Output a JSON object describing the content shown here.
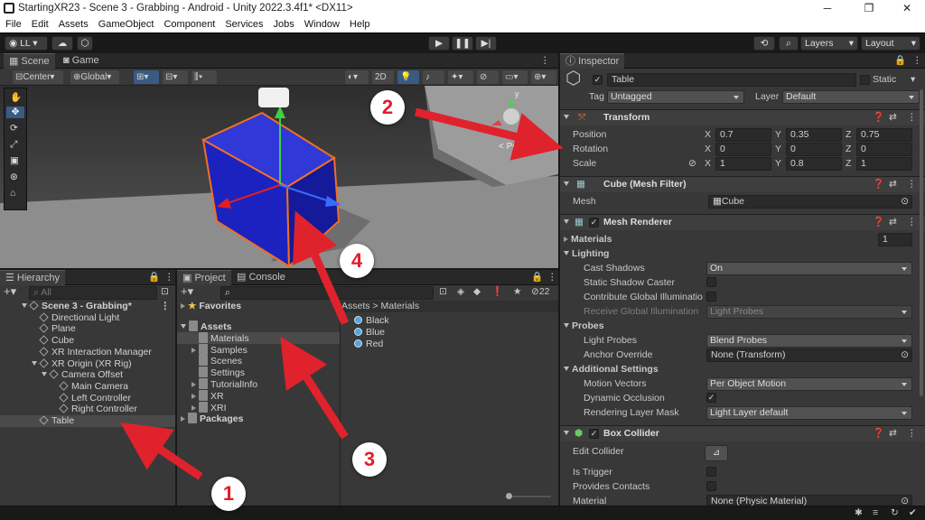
{
  "window": {
    "title": "StartingXR23 - Scene 3 - Grabbing - Android - Unity 2022.3.4f1* <DX11>",
    "min": "─",
    "max": "❐",
    "close": "✕"
  },
  "menu": [
    "File",
    "Edit",
    "Assets",
    "GameObject",
    "Component",
    "Services",
    "Jobs",
    "Window",
    "Help"
  ],
  "toolbar": {
    "account": "LL",
    "layers": "Layers",
    "layout": "Layout"
  },
  "scene": {
    "tab_scene": "Scene",
    "tab_game": "Game",
    "pivot": "Center",
    "space": "Global",
    "mode_2d": "2D",
    "persp": "< Persp",
    "axis_y": "y"
  },
  "hierarchy": {
    "tab": "Hierarchy",
    "search_placeholder": "All",
    "items": [
      {
        "label": "Scene 3 - Grabbing*",
        "depth": 0,
        "kind": "scene",
        "expanded": true
      },
      {
        "label": "Directional Light",
        "depth": 1,
        "kind": "object"
      },
      {
        "label": "Plane",
        "depth": 1,
        "kind": "object"
      },
      {
        "label": "Cube",
        "depth": 1,
        "kind": "object"
      },
      {
        "label": "XR Interaction Manager",
        "depth": 1,
        "kind": "object"
      },
      {
        "label": "XR Origin (XR Rig)",
        "depth": 1,
        "kind": "object",
        "expanded": true
      },
      {
        "label": "Camera Offset",
        "depth": 2,
        "kind": "object",
        "expanded": true
      },
      {
        "label": "Main Camera",
        "depth": 3,
        "kind": "object"
      },
      {
        "label": "Left Controller",
        "depth": 3,
        "kind": "object"
      },
      {
        "label": "Right Controller",
        "depth": 3,
        "kind": "object"
      },
      {
        "label": "Table",
        "depth": 1,
        "kind": "object",
        "selected": true
      }
    ]
  },
  "project": {
    "tab_project": "Project",
    "tab_console": "Console",
    "hidden_count": "22",
    "favorites": "Favorites",
    "tree": [
      {
        "label": "Assets",
        "depth": 0,
        "expanded": true
      },
      {
        "label": "Materials",
        "depth": 1,
        "selected": true
      },
      {
        "label": "Samples",
        "depth": 1,
        "collapsed": true
      },
      {
        "label": "Scenes",
        "depth": 1
      },
      {
        "label": "Settings",
        "depth": 1
      },
      {
        "label": "TutorialInfo",
        "depth": 1,
        "collapsed": true
      },
      {
        "label": "XR",
        "depth": 1,
        "collapsed": true
      },
      {
        "label": "XRI",
        "depth": 1,
        "collapsed": true
      },
      {
        "label": "Packages",
        "depth": 0,
        "collapsed": true
      }
    ],
    "breadcrumb_root": "Assets",
    "breadcrumb_sep": ">",
    "breadcrumb_leaf": "Materials",
    "assets": [
      "Black",
      "Blue",
      "Red"
    ]
  },
  "inspector": {
    "tab": "Inspector",
    "object_name": "Table",
    "static_label": "Static",
    "tag_label": "Tag",
    "tag_value": "Untagged",
    "layer_label": "Layer",
    "layer_value": "Default",
    "transform": {
      "title": "Transform",
      "position": "Position",
      "rotation": "Rotation",
      "scale": "Scale",
      "pos": [
        "0.7",
        "0.35",
        "0.75"
      ],
      "rot": [
        "0",
        "0",
        "0"
      ],
      "scl": [
        "1",
        "0.8",
        "1"
      ],
      "x": "X",
      "y": "Y",
      "z": "Z"
    },
    "mesh_filter": {
      "title": "Cube (Mesh Filter)",
      "mesh_label": "Mesh",
      "mesh_value": "Cube"
    },
    "mesh_renderer": {
      "title": "Mesh Renderer",
      "materials": "Materials",
      "materials_count": "1",
      "lighting": "Lighting",
      "cast_shadows": "Cast Shadows",
      "cast_shadows_value": "On",
      "static_shadow": "Static Shadow Caster",
      "contribute_gi": "Contribute Global Illuminatio",
      "receive_gi": "Receive Global Illumination",
      "receive_gi_value": "Light Probes",
      "probes": "Probes",
      "light_probes": "Light Probes",
      "light_probes_value": "Blend Probes",
      "anchor": "Anchor Override",
      "anchor_value": "None (Transform)",
      "additional": "Additional Settings",
      "motion": "Motion Vectors",
      "motion_value": "Per Object Motion",
      "dynamic_occ": "Dynamic Occlusion",
      "rlm": "Rendering Layer Mask",
      "rlm_value": "Light Layer default"
    },
    "box_collider": {
      "title": "Box Collider",
      "edit": "Edit Collider",
      "trigger": "Is Trigger",
      "contacts": "Provides Contacts",
      "material": "Material",
      "material_value": "None (Physic Material)"
    }
  },
  "annotations": [
    "1",
    "2",
    "3",
    "4"
  ],
  "colors": {
    "arrow": "#e0222c",
    "cube": "#1c22c8",
    "selection": "#f07020"
  }
}
